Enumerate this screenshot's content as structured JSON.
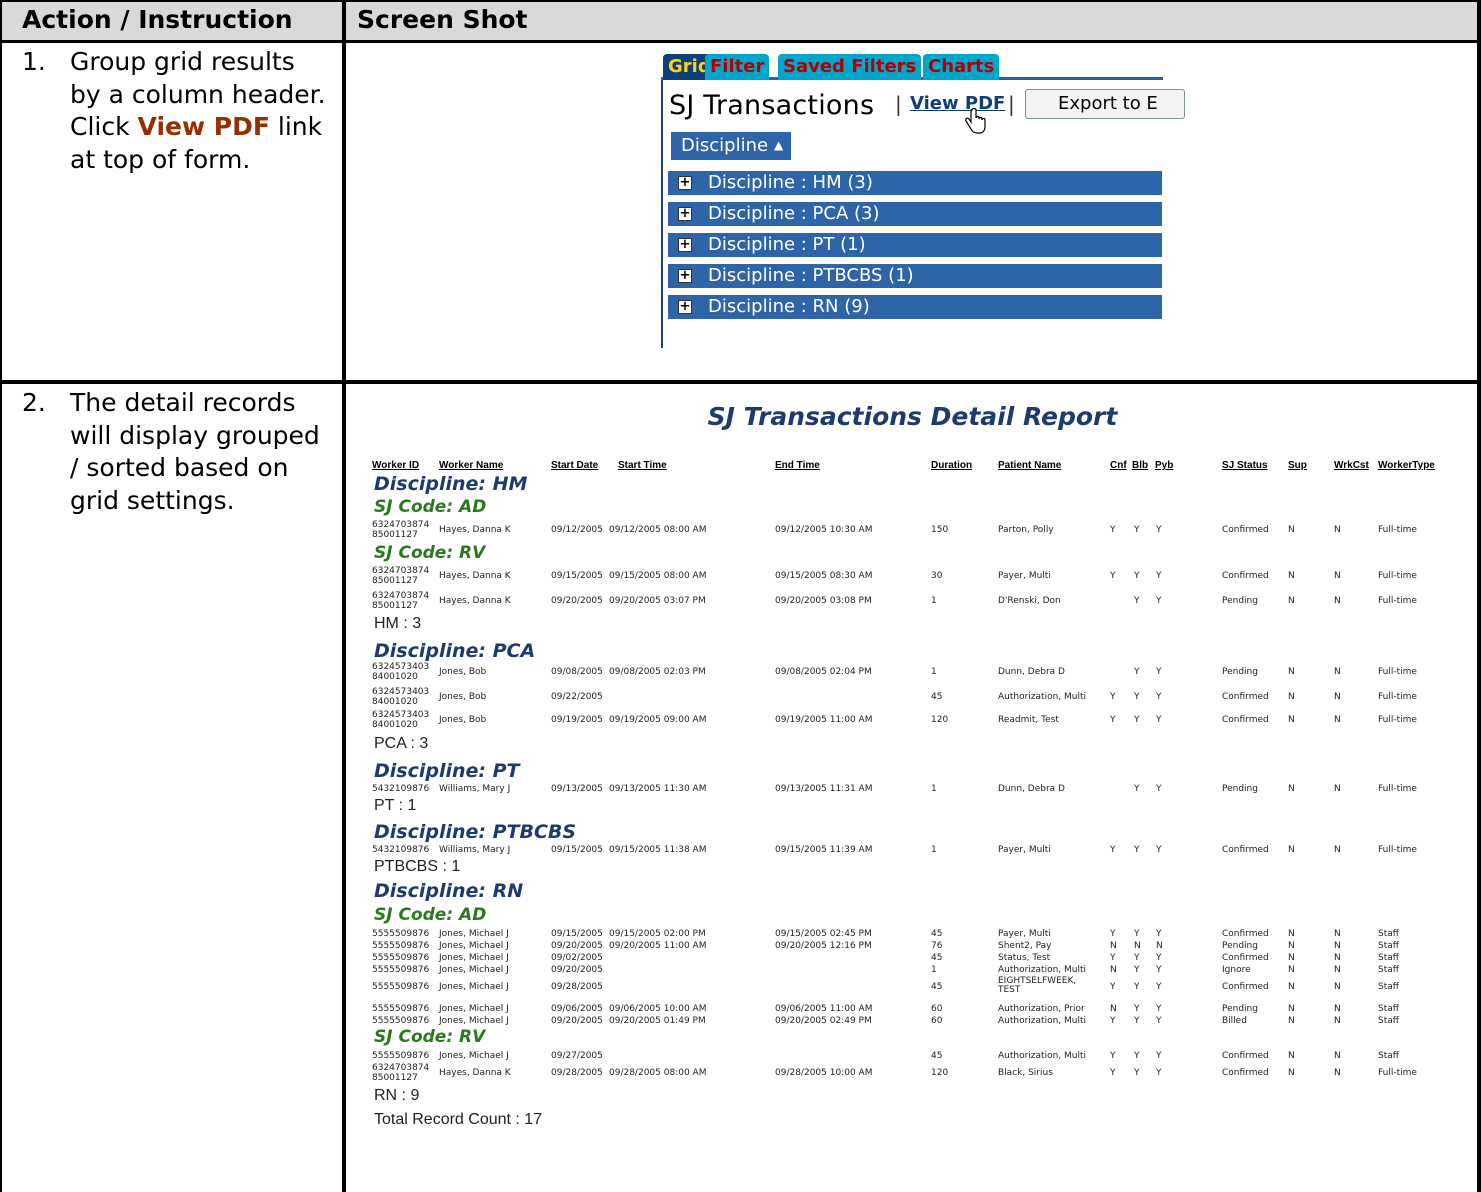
{
  "headers": {
    "action": "Action / Instruction",
    "screenshot": "Screen Shot"
  },
  "steps": [
    {
      "num": "1.",
      "text_before": "Group grid results by a column header.  Click ",
      "link": "View PDF",
      "text_after": " link at top of form."
    },
    {
      "num": "2.",
      "text": "The detail records will display grouped / sorted based on grid settings."
    }
  ],
  "panel1": {
    "tabs": [
      "Grid",
      "Filter",
      "Saved Filters",
      "Charts"
    ],
    "title": "SJ Transactions",
    "sep": "|",
    "view_pdf": "View PDF",
    "export_label": "Export to E",
    "group_by_chip": "Discipline",
    "groups": [
      "Discipline : HM (3)",
      "Discipline : PCA (3)",
      "Discipline : PT (1)",
      "Discipline : PTBCBS (1)",
      "Discipline : RN (9)"
    ]
  },
  "report": {
    "title": "SJ Transactions Detail Report",
    "columns": [
      "Worker ID",
      "Worker Name",
      "Start Date",
      "Start Time",
      "End Time",
      "Duration",
      "Patient Name",
      "Cnf",
      "Blb",
      "Pyb",
      "SJ Status",
      "Sup",
      "WrkCst",
      "WorkerType"
    ],
    "sections": [
      {
        "discipline": "Discipline: HM",
        "codes": [
          {
            "code": "SJ Code: AD",
            "rows": [
              {
                "id1": "6324703874",
                "id2": "85001127",
                "name": "Hayes, Danna K",
                "sdate": "09/12/2005",
                "stime": "09/12/2005 08:00 AM",
                "etime": "09/12/2005 10:30 AM",
                "dur": "150",
                "patient": "Parton, Polly",
                "cnf": "Y",
                "blb": "Y",
                "pyb": "Y",
                "status": "Confirmed",
                "sup": "N",
                "wrk": "N",
                "type": "Full-time"
              }
            ]
          },
          {
            "code": "SJ Code: RV",
            "rows": [
              {
                "id1": "6324703874",
                "id2": "85001127",
                "name": "Hayes, Danna K",
                "sdate": "09/15/2005",
                "stime": "09/15/2005 08:00 AM",
                "etime": "09/15/2005 08:30 AM",
                "dur": "30",
                "patient": "Payer, Multi",
                "cnf": "Y",
                "blb": "Y",
                "pyb": "Y",
                "status": "Confirmed",
                "sup": "N",
                "wrk": "N",
                "type": "Full-time"
              },
              {
                "id1": "6324703874",
                "id2": "85001127",
                "name": "Hayes, Danna K",
                "sdate": "09/20/2005",
                "stime": "09/20/2005 03:07 PM",
                "etime": "09/20/2005 03:08 PM",
                "dur": "1",
                "patient": "D'Renski, Don",
                "cnf": "",
                "blb": "Y",
                "pyb": "Y",
                "status": "Pending",
                "sup": "N",
                "wrk": "N",
                "type": "Full-time"
              }
            ]
          }
        ],
        "count": "HM : 3"
      },
      {
        "discipline": "Discipline: PCA",
        "codes": [
          {
            "code": "",
            "rows": [
              {
                "id1": "6324573403",
                "id2": "84001020",
                "name": "Jones, Bob",
                "sdate": "09/08/2005",
                "stime": "09/08/2005 02:03 PM",
                "etime": "09/08/2005 02:04 PM",
                "dur": "1",
                "patient": "Dunn, Debra D",
                "cnf": "",
                "blb": "Y",
                "pyb": "Y",
                "status": "Pending",
                "sup": "N",
                "wrk": "N",
                "type": "Full-time"
              },
              {
                "id1": "6324573403",
                "id2": "84001020",
                "name": "Jones, Bob",
                "sdate": "09/22/2005",
                "stime": "",
                "etime": "",
                "dur": "45",
                "patient": "Authorization, Multi",
                "cnf": "Y",
                "blb": "Y",
                "pyb": "Y",
                "status": "Confirmed",
                "sup": "N",
                "wrk": "N",
                "type": "Full-time"
              },
              {
                "id1": "6324573403",
                "id2": "84001020",
                "name": "Jones, Bob",
                "sdate": "09/19/2005",
                "stime": "09/19/2005 09:00 AM",
                "etime": "09/19/2005 11:00 AM",
                "dur": "120",
                "patient": "Readmit, Test",
                "cnf": "Y",
                "blb": "Y",
                "pyb": "Y",
                "status": "Confirmed",
                "sup": "N",
                "wrk": "N",
                "type": "Full-time"
              }
            ]
          }
        ],
        "count": "PCA : 3"
      },
      {
        "discipline": "Discipline: PT",
        "codes": [
          {
            "code": "",
            "rows": [
              {
                "id1": "5432109876",
                "id2": "",
                "name": "Williams, Mary J",
                "sdate": "09/13/2005",
                "stime": "09/13/2005 11:30 AM",
                "etime": "09/13/2005 11:31 AM",
                "dur": "1",
                "patient": "Dunn, Debra D",
                "cnf": "",
                "blb": "Y",
                "pyb": "Y",
                "status": "Pending",
                "sup": "N",
                "wrk": "N",
                "type": "Full-time"
              }
            ]
          }
        ],
        "count": "PT : 1"
      },
      {
        "discipline": "Discipline: PTBCBS",
        "codes": [
          {
            "code": "",
            "rows": [
              {
                "id1": "5432109876",
                "id2": "",
                "name": "Williams, Mary J",
                "sdate": "09/15/2005",
                "stime": "09/15/2005 11:38 AM",
                "etime": "09/15/2005 11:39 AM",
                "dur": "1",
                "patient": "Payer, Multi",
                "cnf": "Y",
                "blb": "Y",
                "pyb": "Y",
                "status": "Confirmed",
                "sup": "N",
                "wrk": "N",
                "type": "Full-time"
              }
            ]
          }
        ],
        "count": "PTBCBS : 1"
      },
      {
        "discipline": "Discipline: RN",
        "codes": [
          {
            "code": "SJ Code: AD",
            "rows": [
              {
                "id1": "5555509876",
                "id2": "",
                "name": "Jones, Michael J",
                "sdate": "09/15/2005",
                "stime": "09/15/2005 02:00 PM",
                "etime": "09/15/2005 02:45 PM",
                "dur": "45",
                "patient": "Payer, Multi",
                "cnf": "Y",
                "blb": "Y",
                "pyb": "Y",
                "status": "Confirmed",
                "sup": "N",
                "wrk": "N",
                "type": "Staff"
              },
              {
                "id1": "5555509876",
                "id2": "",
                "name": "Jones, Michael J",
                "sdate": "09/20/2005",
                "stime": "09/20/2005 11:00 AM",
                "etime": "09/20/2005 12:16 PM",
                "dur": "76",
                "patient": "Shent2, Pay",
                "cnf": "N",
                "blb": "N",
                "pyb": "N",
                "status": "Pending",
                "sup": "N",
                "wrk": "N",
                "type": "Staff"
              },
              {
                "id1": "5555509876",
                "id2": "",
                "name": "Jones, Michael J",
                "sdate": "09/02/2005",
                "stime": "",
                "etime": "",
                "dur": "45",
                "patient": "Status, Test",
                "cnf": "Y",
                "blb": "Y",
                "pyb": "Y",
                "status": "Confirmed",
                "sup": "N",
                "wrk": "N",
                "type": "Staff"
              },
              {
                "id1": "5555509876",
                "id2": "",
                "name": "Jones, Michael J",
                "sdate": "09/20/2005",
                "stime": "",
                "etime": "",
                "dur": "1",
                "patient": "Authorization, Multi",
                "cnf": "N",
                "blb": "Y",
                "pyb": "Y",
                "status": "Ignore",
                "sup": "N",
                "wrk": "N",
                "type": "Staff"
              },
              {
                "id1": "5555509876",
                "id2": "",
                "name": "Jones, Michael J",
                "sdate": "09/28/2005",
                "stime": "",
                "etime": "",
                "dur": "45",
                "patient": "EIGHTSELFWEEK, TEST",
                "cnf": "Y",
                "blb": "Y",
                "pyb": "Y",
                "status": "Confirmed",
                "sup": "N",
                "wrk": "N",
                "type": "Staff"
              },
              {
                "id1": "5555509876",
                "id2": "",
                "name": "Jones, Michael J",
                "sdate": "09/06/2005",
                "stime": "09/06/2005 10:00 AM",
                "etime": "09/06/2005 11:00 AM",
                "dur": "60",
                "patient": "Authorization, Prior",
                "cnf": "N",
                "blb": "Y",
                "pyb": "Y",
                "status": "Pending",
                "sup": "N",
                "wrk": "N",
                "type": "Staff"
              },
              {
                "id1": "5555509876",
                "id2": "",
                "name": "Jones, Michael J",
                "sdate": "09/20/2005",
                "stime": "09/20/2005 01:49 PM",
                "etime": "09/20/2005 02:49 PM",
                "dur": "60",
                "patient": "Authorization, Multi",
                "cnf": "Y",
                "blb": "Y",
                "pyb": "Y",
                "status": "Billed",
                "sup": "N",
                "wrk": "N",
                "type": "Staff"
              }
            ]
          },
          {
            "code": "SJ Code: RV",
            "rows": [
              {
                "id1": "5555509876",
                "id2": "",
                "name": "Jones, Michael J",
                "sdate": "09/27/2005",
                "stime": "",
                "etime": "",
                "dur": "45",
                "patient": "Authorization, Multi",
                "cnf": "Y",
                "blb": "Y",
                "pyb": "Y",
                "status": "Confirmed",
                "sup": "N",
                "wrk": "N",
                "type": "Staff"
              },
              {
                "id1": "6324703874",
                "id2": "85001127",
                "name": "Hayes, Danna K",
                "sdate": "09/28/2005",
                "stime": "09/28/2005 08:00 AM",
                "etime": "09/28/2005 10:00 AM",
                "dur": "120",
                "patient": "Black, Sirius",
                "cnf": "Y",
                "blb": "Y",
                "pyb": "Y",
                "status": "Confirmed",
                "sup": "N",
                "wrk": "N",
                "type": "Full-time"
              }
            ]
          }
        ],
        "count": "RN : 9"
      }
    ],
    "total": "Total Record Count : 17"
  }
}
